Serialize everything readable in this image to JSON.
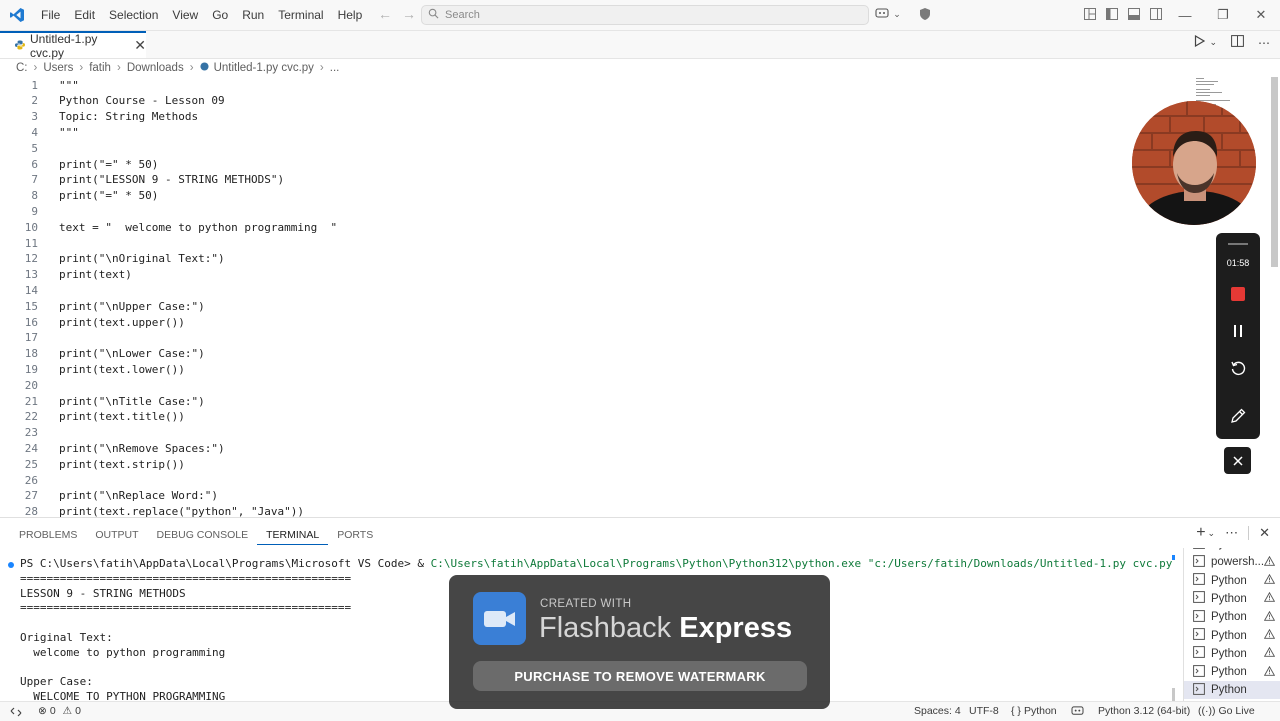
{
  "menu": [
    "File",
    "Edit",
    "Selection",
    "View",
    "Go",
    "Run",
    "Terminal",
    "Help"
  ],
  "search": {
    "placeholder": "Search"
  },
  "tab": {
    "label": "Untitled-1.py cvc.py"
  },
  "breadcrumb": [
    "C:",
    "Users",
    "fatih",
    "Downloads",
    "Untitled-1.py cvc.py",
    "..."
  ],
  "editor": {
    "lines": [
      {
        "n": "1",
        "code": "\"\"\""
      },
      {
        "n": "2",
        "code": "Python Course - Lesson 09"
      },
      {
        "n": "3",
        "code": "Topic: String Methods"
      },
      {
        "n": "4",
        "code": "\"\"\""
      },
      {
        "n": "5",
        "code": ""
      },
      {
        "n": "6",
        "code": "print(\"=\" * 50)"
      },
      {
        "n": "7",
        "code": "print(\"LESSON 9 - STRING METHODS\")"
      },
      {
        "n": "8",
        "code": "print(\"=\" * 50)"
      },
      {
        "n": "9",
        "code": ""
      },
      {
        "n": "10",
        "code": "text = \"  welcome to python programming  \""
      },
      {
        "n": "11",
        "code": ""
      },
      {
        "n": "12",
        "code": "print(\"\\nOriginal Text:\")"
      },
      {
        "n": "13",
        "code": "print(text)"
      },
      {
        "n": "14",
        "code": ""
      },
      {
        "n": "15",
        "code": "print(\"\\nUpper Case:\")"
      },
      {
        "n": "16",
        "code": "print(text.upper())"
      },
      {
        "n": "17",
        "code": ""
      },
      {
        "n": "18",
        "code": "print(\"\\nLower Case:\")"
      },
      {
        "n": "19",
        "code": "print(text.lower())"
      },
      {
        "n": "20",
        "code": ""
      },
      {
        "n": "21",
        "code": "print(\"\\nTitle Case:\")"
      },
      {
        "n": "22",
        "code": "print(text.title())"
      },
      {
        "n": "23",
        "code": ""
      },
      {
        "n": "24",
        "code": "print(\"\\nRemove Spaces:\")"
      },
      {
        "n": "25",
        "code": "print(text.strip())"
      },
      {
        "n": "26",
        "code": ""
      },
      {
        "n": "27",
        "code": "print(\"\\nReplace Word:\")"
      },
      {
        "n": "28",
        "code": "print(text.replace(\"python\", \"Java\"))"
      }
    ]
  },
  "recorder": {
    "time": "01:58"
  },
  "panel": {
    "tabs": [
      "PROBLEMS",
      "OUTPUT",
      "DEBUG CONSOLE",
      "TERMINAL",
      "PORTS"
    ],
    "active_tab": "TERMINAL"
  },
  "terminal": {
    "prompt": "PS C:\\Users\\fatih\\AppData\\Local\\Programs\\Microsoft VS Code> & ",
    "exe": "C:\\Users\\fatih\\AppData\\Local\\Programs\\Python\\Python312\\python.exe",
    "arg": "\"c:/Users/fatih/Downloads/Untitled-1.py cvc.py\"",
    "output": [
      "==================================================",
      "LESSON 9 - STRING METHODS",
      "==================================================",
      "",
      "Original Text:",
      "  welcome to python programming",
      "",
      "Upper Case:",
      "  WELCOME TO PYTHON PROGRAMMING"
    ]
  },
  "terminal_list": [
    {
      "label": "Python",
      "warn": true,
      "partial": true
    },
    {
      "label": "powersh...",
      "warn": true
    },
    {
      "label": "Python",
      "warn": true
    },
    {
      "label": "Python",
      "warn": true
    },
    {
      "label": "Python",
      "warn": true
    },
    {
      "label": "Python",
      "warn": true
    },
    {
      "label": "Python",
      "warn": true
    },
    {
      "label": "Python",
      "warn": true
    },
    {
      "label": "Python",
      "warn": false,
      "active": true
    }
  ],
  "statusbar": {
    "errors": "0",
    "warnings": "0",
    "spaces": "Spaces: 4",
    "encoding": "UTF-8",
    "language": "Python",
    "interpreter": "Python 3.12 (64-bit)",
    "golive": "Go Live"
  },
  "watermark": {
    "created": "CREATED WITH",
    "brand_light": "Flashback",
    "brand_bold": "Express",
    "button": "PURCHASE TO REMOVE WATERMARK"
  },
  "colors": {
    "accent": "#005fb8",
    "record_red": "#e53935",
    "terminal_path_green": "#0f7a3a"
  }
}
